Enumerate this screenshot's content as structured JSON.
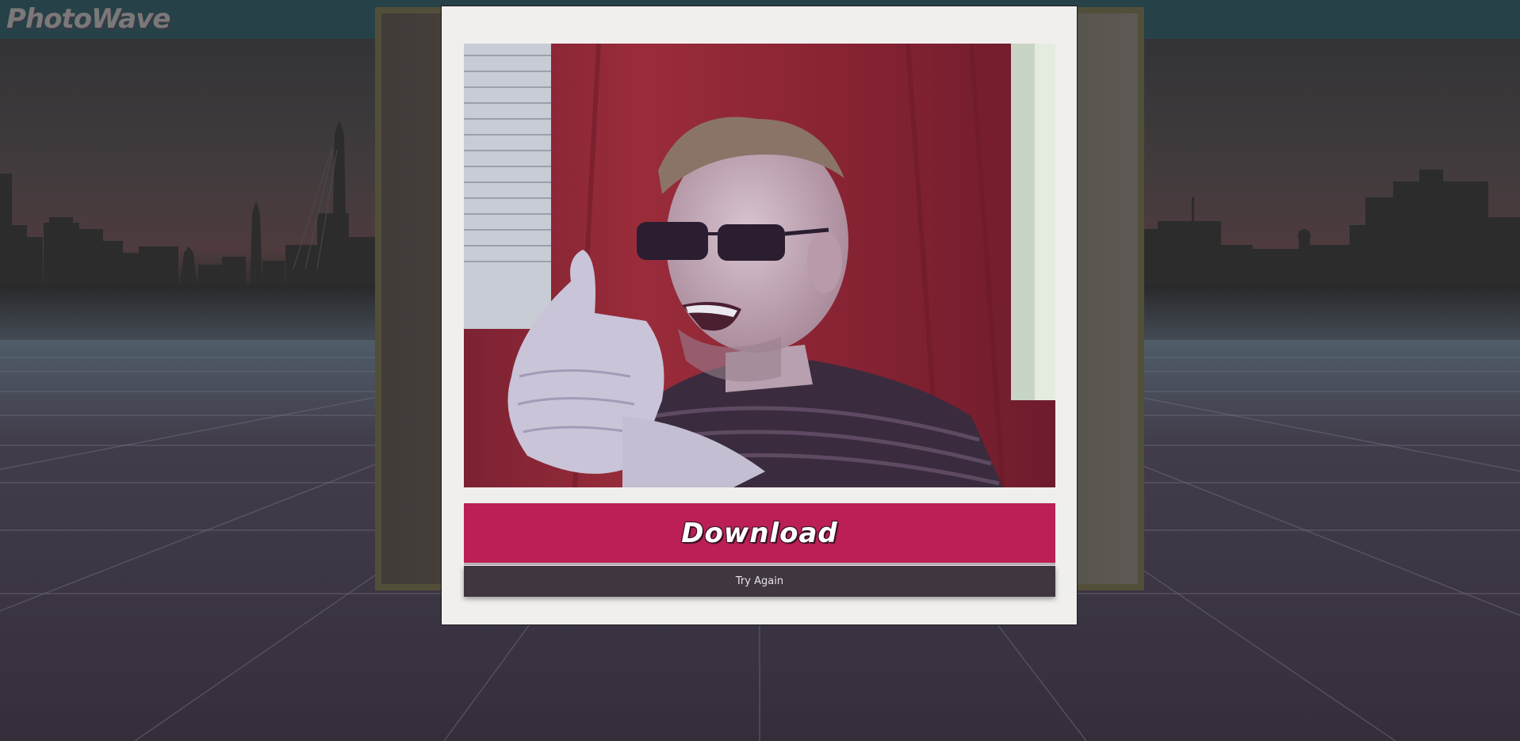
{
  "app": {
    "logo_text": "PhotoWave"
  },
  "modal": {
    "download_label": "Download",
    "try_again_label": "Try Again"
  },
  "colors": {
    "header": "#2c4a52",
    "download_button": "#bb1f55",
    "try_again_button": "#403640",
    "modal_background": "#f0efee"
  }
}
